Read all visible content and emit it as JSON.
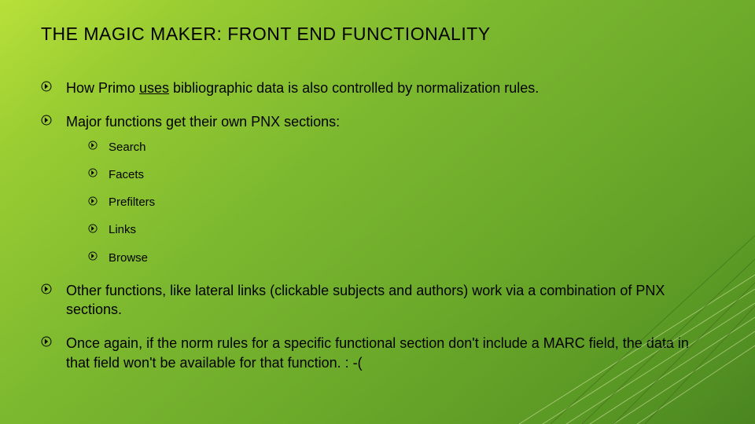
{
  "title": "THE MAGIC MAKER: FRONT END FUNCTIONALITY",
  "bullets": {
    "b1_pre": "How Primo ",
    "b1_underlined": "uses",
    "b1_post": " bibliographic data is also controlled by normalization rules.",
    "b2": "Major functions get their own PNX sections:",
    "sub": {
      "s1": "Search",
      "s2": "Facets",
      "s3": "Prefilters",
      "s4": "Links",
      "s5": "Browse"
    },
    "b3": "Other functions, like lateral links (clickable subjects and authors) work via a combination of PNX sections.",
    "b4": "Once again, if the norm rules for a specific functional section don't include a MARC field, the data in that field won't be available for that function.  : -("
  }
}
